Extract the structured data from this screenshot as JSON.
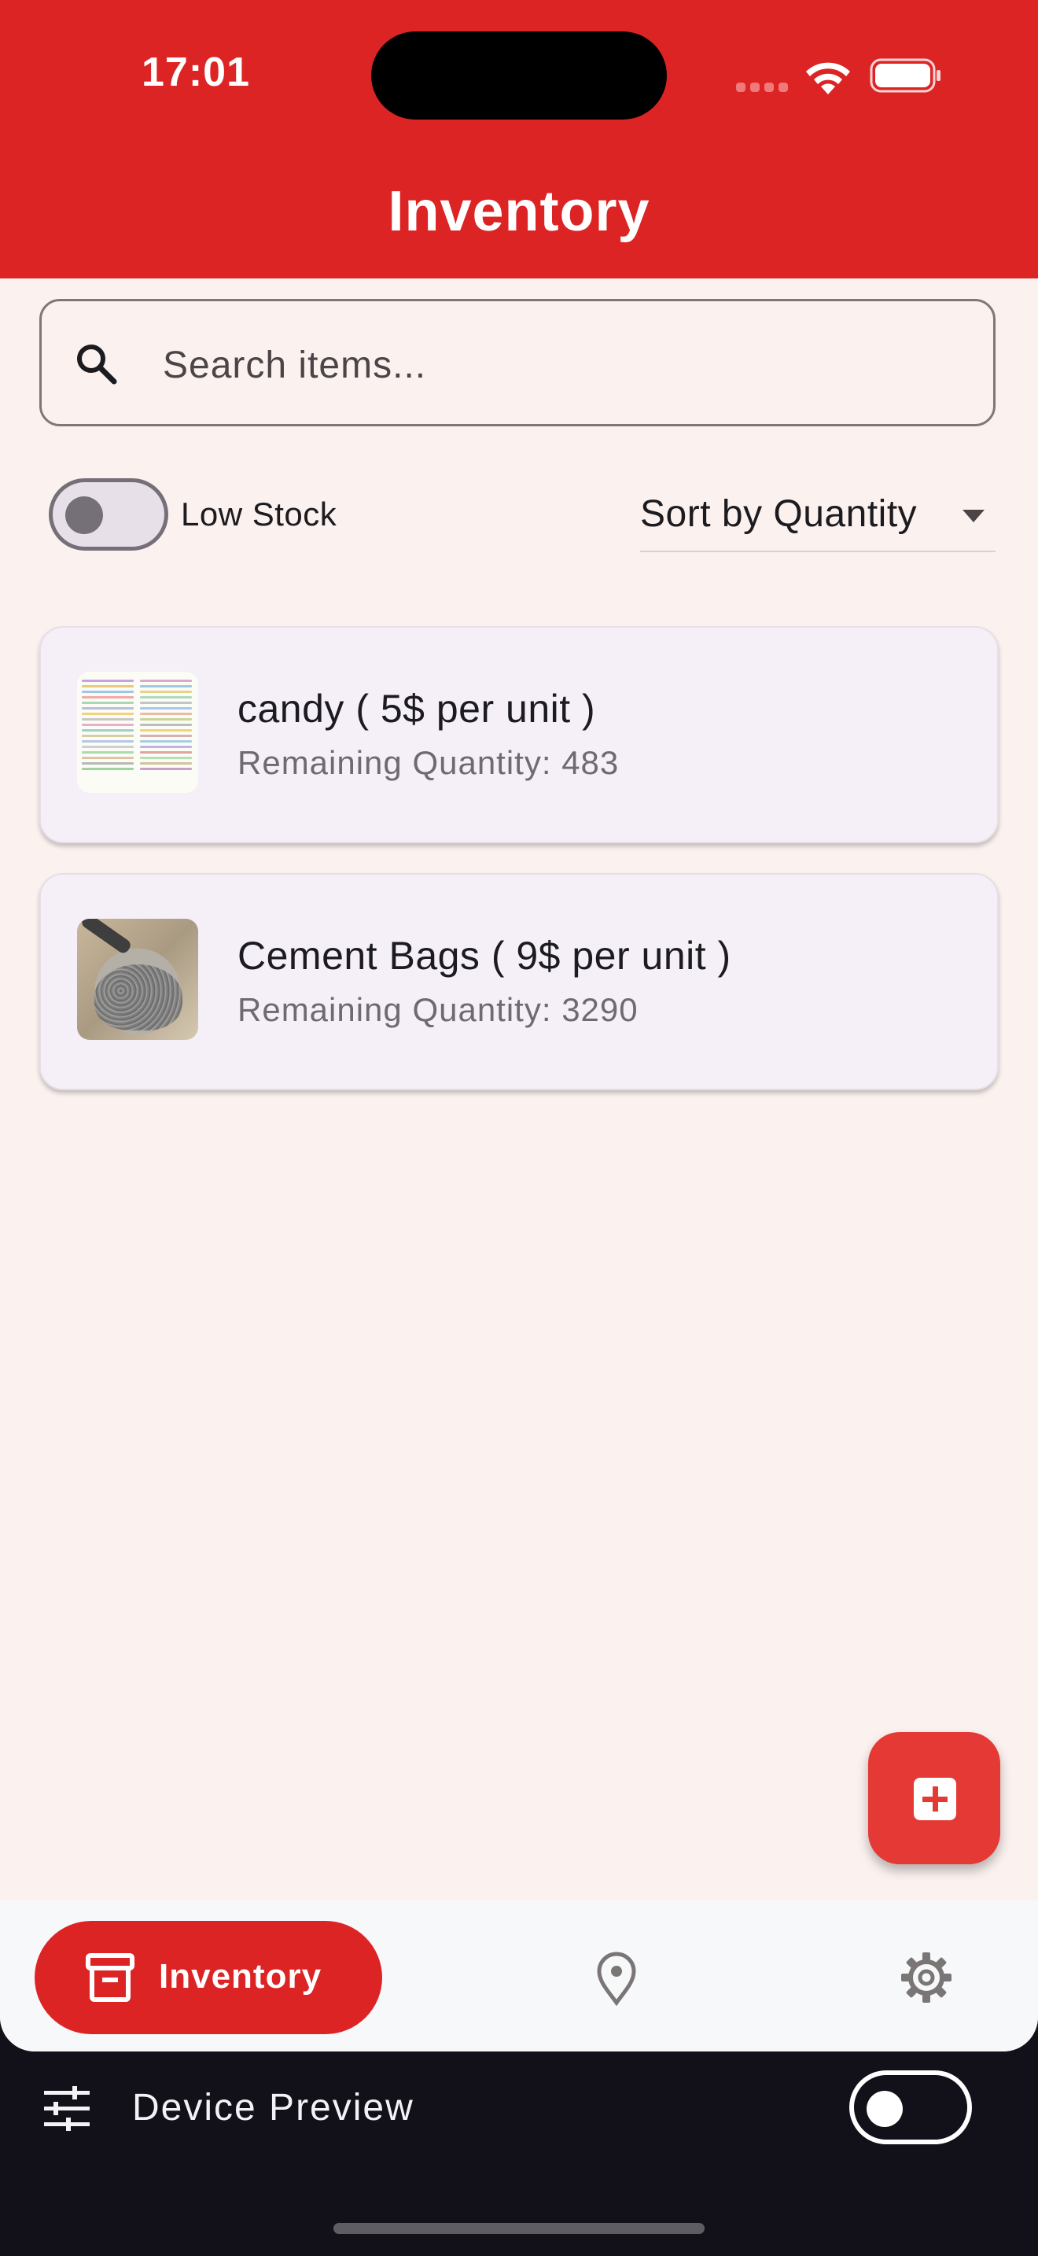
{
  "status_bar": {
    "time": "17:01"
  },
  "app_bar": {
    "title": "Inventory",
    "color": "#dd2424"
  },
  "search": {
    "placeholder": "Search items..."
  },
  "filters": {
    "low_stock_label": "Low Stock",
    "low_stock_enabled": false,
    "sort_label": "Sort by Quantity"
  },
  "items": [
    {
      "title": "candy ( 5$ per unit )",
      "subtitle": "Remaining Quantity: 483",
      "thumbnail": "candy-image"
    },
    {
      "title": "Cement Bags ( 9$ per unit )",
      "subtitle": "Remaining Quantity: 3290",
      "thumbnail": "cement-bag-image"
    }
  ],
  "fab": {
    "icon": "add-box-icon"
  },
  "bottom_nav": {
    "items": [
      {
        "label": "Inventory",
        "icon": "archive-box-icon",
        "active": true
      },
      {
        "label": "",
        "icon": "location-pin-icon",
        "active": false
      },
      {
        "label": "",
        "icon": "gear-icon",
        "active": false
      }
    ]
  },
  "device_preview": {
    "label": "Device Preview",
    "enabled": false
  }
}
